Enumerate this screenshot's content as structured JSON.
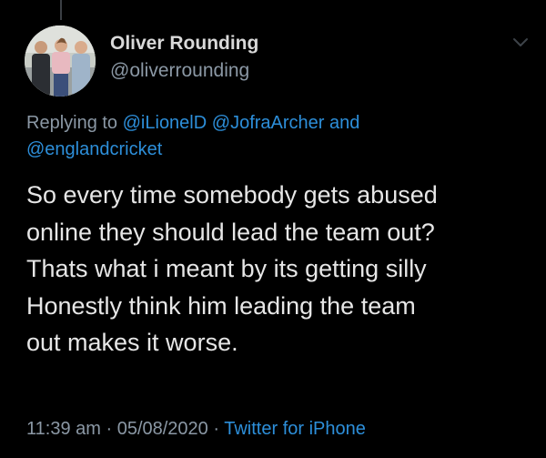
{
  "tweet": {
    "author": {
      "display_name": "Oliver Rounding",
      "handle": "@oliverrounding",
      "avatar": "avatar-photo"
    },
    "reply": {
      "prefix": "Replying to ",
      "mentions": [
        "@iLionelD",
        "@JofraArcher",
        "@englandcricket"
      ],
      "conjunction": "and"
    },
    "text_lines": [
      "So every time somebody gets abused",
      "online they should lead the team out?",
      "Thats what i meant by its getting silly",
      "Honestly think him leading the team",
      "out makes it worse."
    ],
    "meta": {
      "time": "11:39 am",
      "separator": "·",
      "date": "05/08/2020",
      "source": "Twitter for iPhone"
    },
    "menu_icon": "chevron-down-icon"
  },
  "colors": {
    "background": "#000000",
    "primary_text": "#d9d9d9",
    "secondary_text": "#8b98a5",
    "link": "#2d8fda"
  }
}
